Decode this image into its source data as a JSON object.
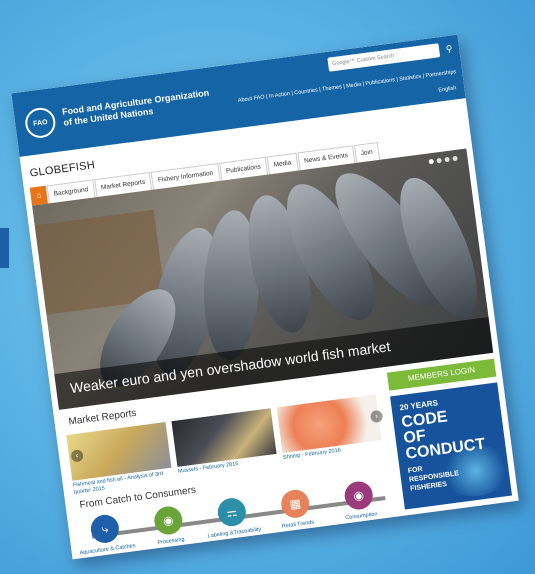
{
  "header": {
    "org_line1": "Food and Agriculture Organization",
    "org_line2": "of the United Nations",
    "logo_text": "FAO",
    "search_placeholder": "Google™ Custom Search",
    "top_links": "About FAO | In Action | Countries | Themes | Media | Publications | Statistics | Partnerships",
    "language": "English"
  },
  "site": {
    "title": "GLOBEFISH",
    "nav": [
      "Background",
      "Market Reports",
      "Fishery Information",
      "Publications",
      "Media",
      "News & Events",
      "Join"
    ]
  },
  "hero": {
    "caption": "Weaker euro and yen overshadow world fish market"
  },
  "market_reports": {
    "title": "Market Reports",
    "items": [
      {
        "caption": "Fishmeal and fish oil - Analysis of 3rd quarter 2015"
      },
      {
        "caption": "Mussels - February 2016"
      },
      {
        "caption": "Shrimp - February 2016"
      }
    ]
  },
  "catch_to_consumers": {
    "title": "From Catch to Consumers",
    "items": [
      {
        "label": "Aquaculture & Catches",
        "icon": "hook-icon",
        "color": "#1f5ea8"
      },
      {
        "label": "Processing",
        "icon": "can-icon",
        "color": "#6aa33a"
      },
      {
        "label": "Labeling &Traceability",
        "icon": "tag-icon",
        "color": "#2b8fa8"
      },
      {
        "label": "Retail Trends",
        "icon": "store-icon",
        "color": "#e7825a"
      },
      {
        "label": "Consumption",
        "icon": "fish-plate-icon",
        "color": "#9b3a7a"
      }
    ]
  },
  "sidebar": {
    "members_login": "MEMBERS LOGIN",
    "coc_years": "20 YEARS",
    "coc_word1": "CODE",
    "coc_word2": "OF",
    "coc_word3": "CONDUCT",
    "coc_for": "FOR",
    "coc_line1": "RESPONSIBLE",
    "coc_line2": "FISHERIES"
  }
}
